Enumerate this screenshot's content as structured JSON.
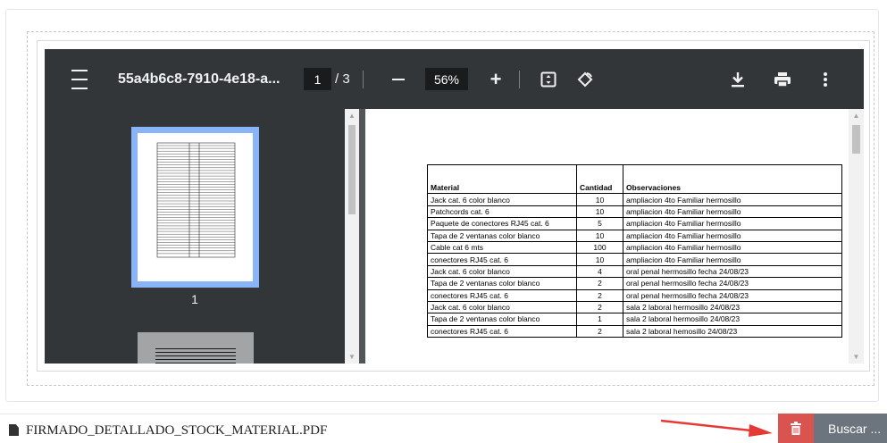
{
  "viewer": {
    "doc_title": "55a4b6c8-7910-4e18-a...",
    "page_current": "1",
    "page_total_label": "/ 3",
    "zoom": "56%",
    "icons": [
      "menu-icon",
      "zoom-out-icon",
      "zoom-in-icon",
      "fit-to-page-icon",
      "rotate-icon",
      "download-icon",
      "print-icon",
      "more-vert-icon"
    ]
  },
  "thumbnails": {
    "items": [
      {
        "label": "1"
      }
    ]
  },
  "table": {
    "headers": [
      "Material",
      "Cantidad",
      "Observaciones"
    ],
    "rows": [
      [
        "Jack cat. 6 color blanco",
        "10",
        "ampliacion 4to Familiar hermosillo"
      ],
      [
        "Patchcords cat. 6",
        "10",
        "ampliacion 4to Familiar hermosillo"
      ],
      [
        "Paquete de conectores RJ45 cat. 6",
        "5",
        "ampliacion 4to Familiar hermosillo"
      ],
      [
        "Tapa de 2 ventanas color blanco",
        "10",
        "ampliacion 4to Familiar hermosillo"
      ],
      [
        "Cable cat 6 mts",
        "100",
        "ampliacion 4to Familiar hermosillo"
      ],
      [
        "conectores RJ45 cat. 6",
        "10",
        "ampliacion 4to Familiar hermosillo"
      ],
      [
        "Jack cat. 6 color blanco",
        "4",
        "oral penal hermosillo fecha 24/08/23"
      ],
      [
        "Tapa de 2 ventanas color blanco",
        "2",
        "oral penal hermosillo fecha 24/08/23"
      ],
      [
        "conectores RJ45 cat. 6",
        "2",
        "oral penal hermosillo fecha 24/08/23"
      ],
      [
        "Jack cat. 6 color blanco",
        "2",
        "sala 2 laboral hermosillo 24/08/23"
      ],
      [
        "Tapa de 2 ventanas color blanco",
        "1",
        "sala 2 laboral hermosillo 24/08/23"
      ],
      [
        "conectores RJ45 cat. 6",
        "2",
        "sala 2 laboral hemosillo 24/08/23"
      ]
    ]
  },
  "file": {
    "name": "FIRMADO_DETALLADO_STOCK_MATERIAL.PDF",
    "icon": "file-icon"
  },
  "actions": {
    "delete_icon": "trash-icon",
    "search_label": "Buscar ..."
  },
  "colors": {
    "toolbar": "#323639",
    "viewer_bg": "#525659",
    "thumb_selected": "#8ab4f8",
    "delete": "#d9534f",
    "search": "#6c757d",
    "annotation_arrow": "#e53935"
  }
}
